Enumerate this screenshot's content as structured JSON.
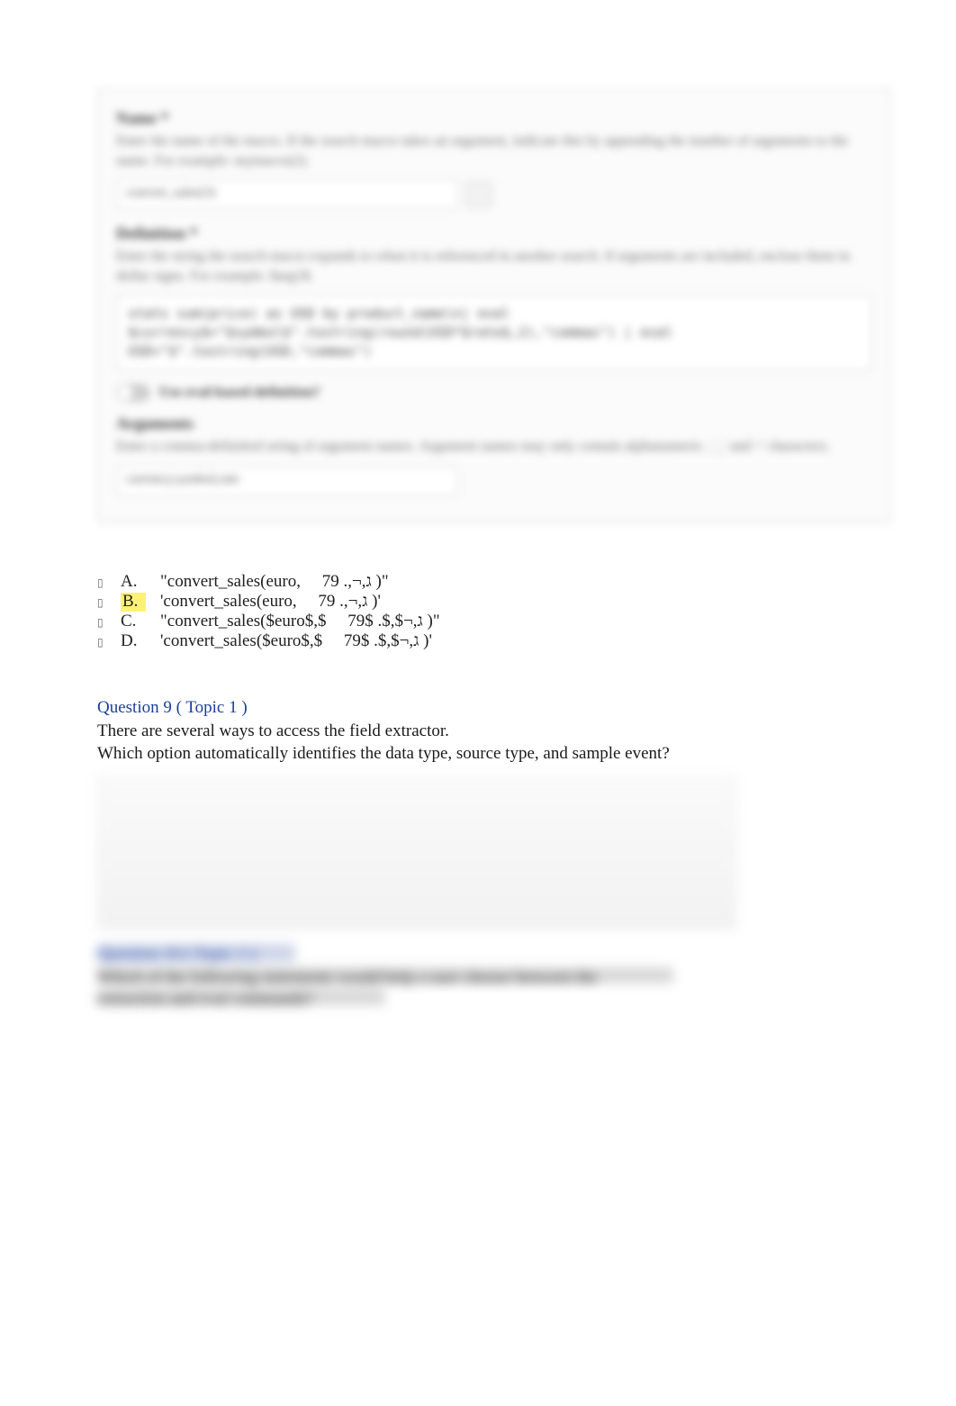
{
  "panel": {
    "name_label": "Name *",
    "name_hint": "Enter the name of the macro. If the search macro takes an argument, indicate this by appending the number of arguments to the name. For example: mymacro(2).",
    "name_value": "convert_sales(3)",
    "definition_label": "Definition *",
    "definition_hint": "Enter the string the search macro expands to when it is referenced in another search. If arguments are included, enclose them in dollar signs. For example: $arg1$.",
    "definition_value": "stats  sum(price)  as  USD  by  product_name\\n| eval  $currency$=\"$symbol$\".tostring(round(USD*$rate$,2),\"commas\")  | eval  USD=\"$\".tostring(USD,\"commas\")",
    "eval_toggle_label": "Use eval-based definition?",
    "arguments_label": "Arguments",
    "arguments_hint": "Enter a comma-delimited string of argument names. Argument names may only contain alphanumeric , '_' and '-' characters.",
    "arguments_value": "currency,symbol,rate"
  },
  "options": {
    "a": {
      "letter": "A.",
      "text": "\"convert_sales(euro,     79 .,¬,ג )\""
    },
    "b": {
      "letter": "B.",
      "text": "'convert_sales(euro,     79 .,¬,ג )'"
    },
    "c": {
      "letter": "C.",
      "text": "\"convert_sales($euro$,$     79$ .$,$¬,ג )\""
    },
    "d": {
      "letter": "D.",
      "text": "'convert_sales($euro$,$     79$ .$,$¬,ג )'"
    }
  },
  "q9": {
    "title": "Question 9 ( Topic 1 )",
    "line1": "There are several ways to access the field extractor.",
    "line2": "Which option automatically identifies the data type, source type, and sample event?"
  },
  "blur2": {
    "q10_title": "Question 10 ( Topic 1 )",
    "q10_line1": "Which of the following statements would help a user choose between the",
    "q10_line2": "extraction and eval commands?"
  }
}
